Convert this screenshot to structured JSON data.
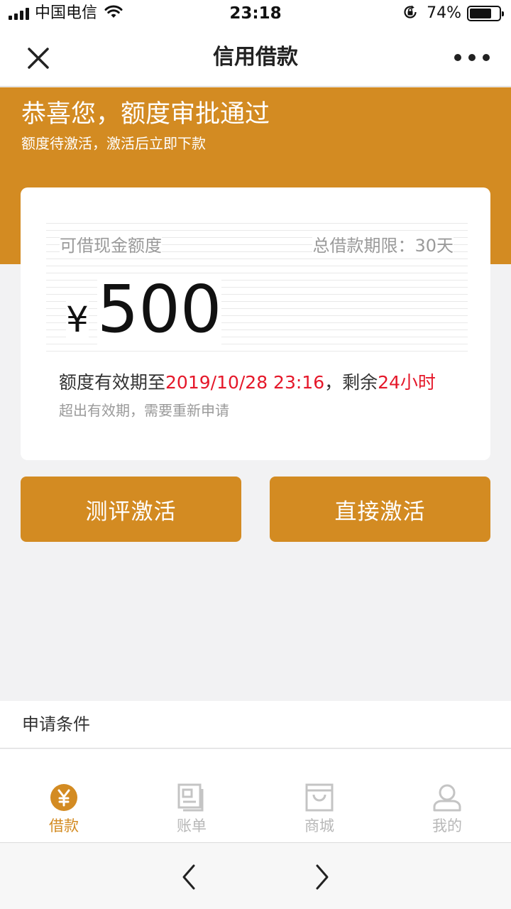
{
  "status_bar": {
    "carrier": "中国电信",
    "time": "23:18",
    "battery_percent": "74%",
    "battery_level": 0.74
  },
  "nav": {
    "title": "信用借款",
    "close_icon": "close-icon",
    "more_icon": "more-icon"
  },
  "hero": {
    "title": "恭喜您，额度审批通过",
    "subtitle": "额度待激活，激活后立即下款"
  },
  "card": {
    "limit_label": "可借现金额度",
    "term": "总借款期限：30天",
    "currency": "¥",
    "amount": "500",
    "validity_prefix": "额度有效期至",
    "validity_date": "2019/10/28 23:16",
    "validity_sep": "，剩余",
    "validity_remaining": "24小时",
    "validity_note": "超出有效期，需要重新申请"
  },
  "actions": {
    "evaluate_label": "测评激活",
    "direct_label": "直接激活"
  },
  "conditions": {
    "label": "申请条件"
  },
  "tabs": [
    {
      "label": "借款",
      "icon": "yen-circle-icon",
      "active": true
    },
    {
      "label": "账单",
      "icon": "bill-icon",
      "active": false
    },
    {
      "label": "商城",
      "icon": "shop-bag-icon",
      "active": false
    },
    {
      "label": "我的",
      "icon": "user-icon",
      "active": false
    }
  ],
  "browser": {
    "back_icon": "chevron-left-icon",
    "forward_icon": "chevron-right-icon"
  },
  "colors": {
    "accent": "#d38b22",
    "highlight_red": "#e5182a",
    "inactive_tab": "#b8b8b8"
  }
}
